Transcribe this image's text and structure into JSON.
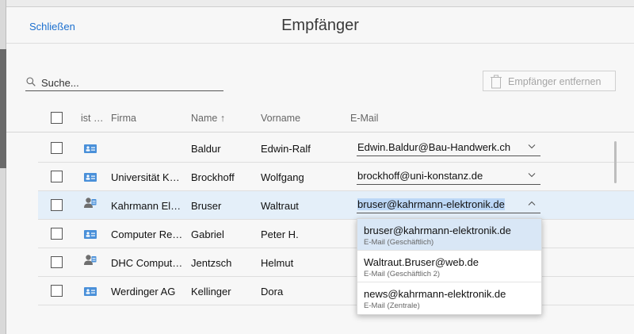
{
  "dialog": {
    "title": "Empfänger",
    "close_label": "Schließen"
  },
  "search": {
    "placeholder": "Suche..."
  },
  "toolbar": {
    "remove_label": "Empfänger entfernen"
  },
  "columns": {
    "type": "ist …",
    "company": "Firma",
    "name": "Name ↑",
    "firstname": "Vorname",
    "email": "E-Mail"
  },
  "rows": [
    {
      "contact_icon": "contact-card-icon",
      "company": "",
      "name": "Baldur",
      "firstname": "Edwin-Ralf",
      "email": "Edwin.Baldur@Bau-Handwerk.ch",
      "checked": false
    },
    {
      "contact_icon": "contact-card-icon",
      "company": "Universität K…",
      "name": "Brockhoff",
      "firstname": "Wolfgang",
      "email": "brockhoff@uni-konstanz.de",
      "checked": false
    },
    {
      "contact_icon": "person-card-icon",
      "company": "Kahrmann El…",
      "name": "Bruser",
      "firstname": "Waltraut",
      "email": "bruser@kahrmann-elektronik.de",
      "checked": false,
      "selected": true,
      "dropdown_open": true
    },
    {
      "contact_icon": "contact-card-icon",
      "company": "Computer Re…",
      "name": "Gabriel",
      "firstname": "Peter H.",
      "email": "",
      "checked": false
    },
    {
      "contact_icon": "person-card-icon",
      "company": "DHC Comput…",
      "name": "Jentzsch",
      "firstname": "Helmut",
      "email": "",
      "checked": false
    },
    {
      "contact_icon": "contact-card-icon",
      "company": "Werdinger AG",
      "name": "Kellinger",
      "firstname": "Dora",
      "email": "",
      "checked": false
    }
  ],
  "email_dropdown": {
    "options": [
      {
        "address": "bruser@kahrmann-elektronik.de",
        "type": "E-Mail (Geschäftlich)",
        "active": true
      },
      {
        "address": "Waltraut.Bruser@web.de",
        "type": "E-Mail (Geschäftlich 2)",
        "active": false
      },
      {
        "address": "news@kahrmann-elektronik.de",
        "type": "E-Mail (Zentrale)",
        "active": false
      }
    ]
  },
  "colors": {
    "accent": "#1b6fcf",
    "selected_row": "#e4eff9",
    "contact_icon": "#4a90d9",
    "person_icon": "#6f6f6f"
  }
}
